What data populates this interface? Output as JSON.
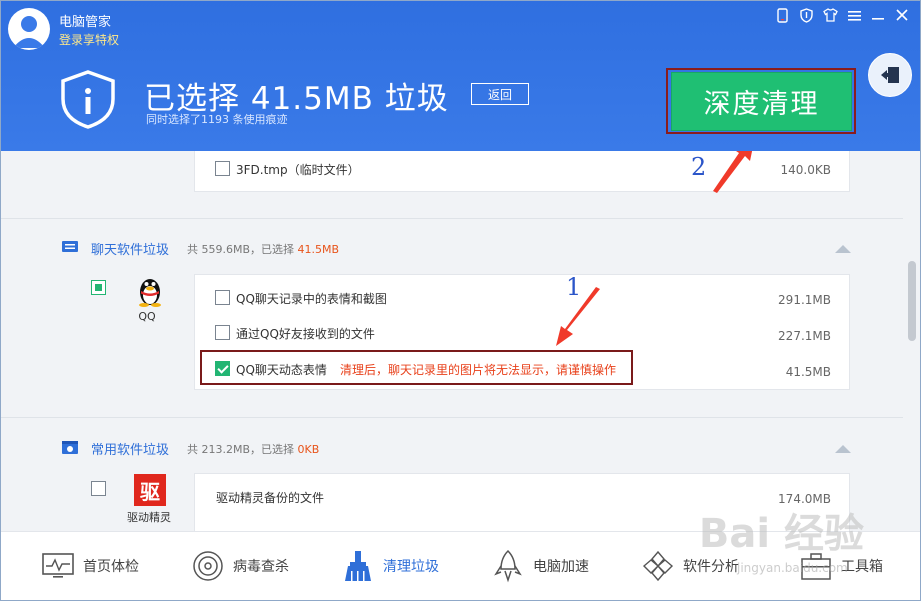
{
  "header": {
    "app_name": "电脑管家",
    "login_link": "登录享特权",
    "headline": "已选择 41.5MB 垃圾",
    "subline": "同时选择了1193 条使用痕迹",
    "back_label": "返回",
    "deep_clean_label": "深度清理",
    "window_controls": [
      "phone-icon",
      "shield-icon",
      "shirt-icon",
      "menu-icon",
      "minimize-icon",
      "close-icon"
    ]
  },
  "content": {
    "temp_item": {
      "label": "3FD.tmp（临时文件）",
      "size": "140.0KB"
    },
    "chat_section": {
      "title": "聊天软件垃圾",
      "info_prefix": "共 559.6MB，已选择",
      "info_selected": "41.5MB",
      "app": {
        "name": "QQ",
        "items": [
          {
            "label": "QQ聊天记录中的表情和截图",
            "size": "291.1MB",
            "checked": false
          },
          {
            "label": "通过QQ好友接收到的文件",
            "size": "227.1MB",
            "checked": false
          },
          {
            "label": "QQ聊天动态表情",
            "size": "41.5MB",
            "checked": true,
            "warning": "清理后，聊天记录里的图片将无法显示，请谨慎操作"
          }
        ]
      }
    },
    "common_section": {
      "title": "常用软件垃圾",
      "info_prefix": "共 213.2MB，已选择",
      "info_selected": "0KB",
      "app": {
        "name": "驱动精灵",
        "logo_char": "驱",
        "items": [
          {
            "label": "驱动精灵备份的文件",
            "size": "174.0MB"
          }
        ]
      }
    },
    "annotations": {
      "one": "1",
      "two": "2"
    }
  },
  "bottom_nav": [
    {
      "label": "首页体检",
      "icon": "monitor-icon",
      "active": false
    },
    {
      "label": "病毒查杀",
      "icon": "target-icon",
      "active": false
    },
    {
      "label": "清理垃圾",
      "icon": "broom-icon",
      "active": true
    },
    {
      "label": "电脑加速",
      "icon": "rocket-icon",
      "active": false
    },
    {
      "label": "软件分析",
      "icon": "puzzle-icon",
      "active": false
    },
    {
      "label": "工具箱",
      "icon": "toolbox-icon",
      "active": false
    }
  ],
  "watermark": {
    "main": "Bai 经验",
    "sub": "jingyan.baidu.com"
  },
  "colors": {
    "header_blue": "#3a7ae8",
    "accent_green": "#1fbf73",
    "warn_red": "#e8411b",
    "link_blue": "#2f6fd8"
  }
}
